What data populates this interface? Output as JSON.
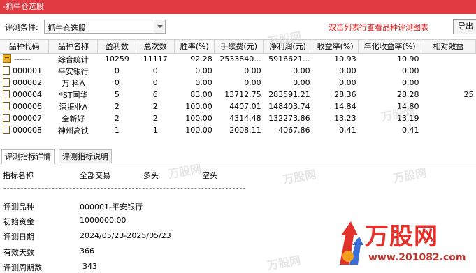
{
  "window": {
    "title": "-抓牛仓选股"
  },
  "toolbar": {
    "condition_label": "评测条件:",
    "condition_value": "抓牛仓选股",
    "hint": "双击列表行查看品种评测图表",
    "export_label": "导出"
  },
  "grid": {
    "columns": [
      "品种代码",
      "品种名称",
      "盈利数",
      "总次数",
      "胜率(%)",
      "手续费(元)",
      "净利润(元)",
      "收益率(%)",
      "年化收益率(%)",
      "相对效益"
    ],
    "rows": [
      {
        "icon": "summary-icon",
        "code": "------",
        "name": "综合统计",
        "win": "10259",
        "total": "11117",
        "winrate": "92.28",
        "fee": "2533840...",
        "profit": "5916621...",
        "ret": "10.93",
        "annual": "10.90",
        "rel": ""
      },
      {
        "icon": "document-icon",
        "code": "000001",
        "name": "平安银行",
        "win": "0",
        "total": "0",
        "winrate": "0.00",
        "fee": "0.00",
        "profit": "0.00",
        "ret": "0.00",
        "annual": "0.00",
        "rel": ""
      },
      {
        "icon": "document-icon",
        "code": "000002",
        "name": "万 科A",
        "win": "0",
        "total": "0",
        "winrate": "0.00",
        "fee": "0.00",
        "profit": "0.00",
        "ret": "0.00",
        "annual": "0.00",
        "rel": ""
      },
      {
        "icon": "document-icon",
        "code": "000004",
        "name": "*ST国华",
        "win": "5",
        "total": "6",
        "winrate": "83.00",
        "fee": "13712.75",
        "profit": "283591.21",
        "ret": "28.36",
        "annual": "28.28",
        "rel": "25"
      },
      {
        "icon": "document-icon",
        "code": "000006",
        "name": "深振业A",
        "win": "2",
        "total": "2",
        "winrate": "100.00",
        "fee": "4407.01",
        "profit": "148403.74",
        "ret": "14.84",
        "annual": "14.80",
        "rel": ""
      },
      {
        "icon": "document-icon",
        "code": "000007",
        "name": "全新好",
        "win": "2",
        "total": "2",
        "winrate": "100.00",
        "fee": "4314.48",
        "profit": "132273.86",
        "ret": "13.23",
        "annual": "13.19",
        "rel": ""
      },
      {
        "icon": "document-icon",
        "code": "000008",
        "name": "神州高铁",
        "win": "1",
        "total": "1",
        "winrate": "100.00",
        "fee": "2008.11",
        "profit": "4067.86",
        "ret": "0.41",
        "annual": "0.41",
        "rel": ""
      }
    ]
  },
  "tabs": [
    {
      "label": "评测指标详情",
      "active": true
    },
    {
      "label": "评测指标说明",
      "active": false
    }
  ],
  "detail": {
    "headers": [
      "指标名称",
      "全部交易",
      "多头",
      "空头"
    ],
    "items": [
      {
        "label": "评测品种",
        "value": "000001-平安银行"
      },
      {
        "label": "初始资金",
        "value": "1000000.00"
      },
      {
        "label": "评测日期",
        "value": "2024/05/23-2025/05/23"
      },
      {
        "label": "有效天数",
        "value": "366"
      },
      {
        "label": "评测周期数",
        "value": "343"
      }
    ]
  },
  "watermark": {
    "text": "万股网",
    "url": "www.201082.com"
  },
  "colors": {
    "titlebar": "#e03a43",
    "hint": "#e01818",
    "logo": "#e3322b"
  }
}
